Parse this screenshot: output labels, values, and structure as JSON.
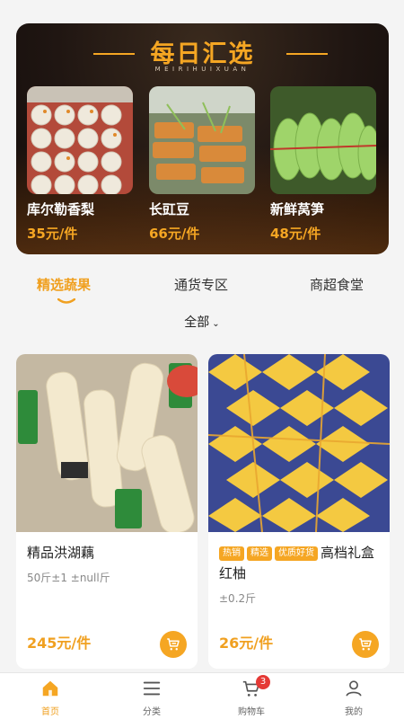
{
  "banner": {
    "title": "每日汇选",
    "subtitle": "MEIRIHUIXUAN",
    "items": [
      {
        "name": "库尔勒香梨",
        "price": "35元/件"
      },
      {
        "name": "长豇豆",
        "price": "66元/件"
      },
      {
        "name": "新鲜莴笋",
        "price": "48元/件"
      }
    ]
  },
  "tabs": [
    {
      "label": "精选蔬果",
      "active": true
    },
    {
      "label": "通货专区",
      "active": false
    },
    {
      "label": "商超食堂",
      "active": false
    }
  ],
  "filter": {
    "label": "全部"
  },
  "products": [
    {
      "title": "精品洪湖藕",
      "tags": [],
      "spec": "50斤±1 ±null斤",
      "price": "245元/件"
    },
    {
      "title": "高档礼盒红柚",
      "tags": [
        "热销",
        "精选",
        "优质好货"
      ],
      "spec": "±0.2斤",
      "price": "26元/件"
    }
  ],
  "nav": [
    {
      "label": "首页",
      "icon": "home-icon",
      "active": true
    },
    {
      "label": "分类",
      "icon": "menu-icon",
      "active": false
    },
    {
      "label": "购物车",
      "icon": "cart-icon",
      "active": false,
      "badge": "3"
    },
    {
      "label": "我的",
      "icon": "user-icon",
      "active": false
    }
  ],
  "colors": {
    "accent": "#f5a623",
    "badge": "#e53935"
  }
}
